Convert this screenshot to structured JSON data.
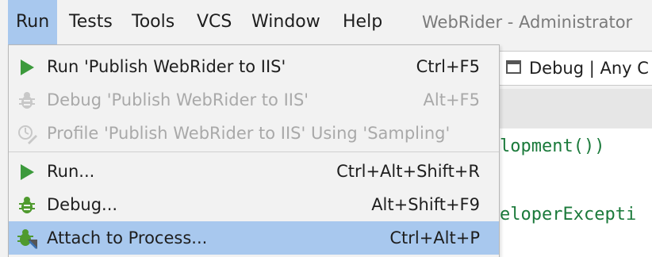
{
  "menubar": {
    "items": [
      {
        "label": "Run"
      },
      {
        "label": "Tests"
      },
      {
        "label": "Tools"
      },
      {
        "label": "VCS"
      },
      {
        "label": "Window"
      },
      {
        "label": "Help"
      }
    ],
    "window_title": "WebRider - Administrator"
  },
  "toolbar": {
    "configuration_label": "Debug | Any C"
  },
  "editor": {
    "lines": [
      "lopment())",
      "eloperExcepti"
    ]
  },
  "run_menu": {
    "items": [
      {
        "label": "Run 'Publish WebRider to IIS'",
        "shortcut": "Ctrl+F5",
        "icon": "run-triangle-icon",
        "enabled": true
      },
      {
        "label": "Debug 'Publish WebRider to IIS'",
        "shortcut": "Alt+F5",
        "icon": "debug-bug-icon",
        "enabled": false
      },
      {
        "label": "Profile 'Publish WebRider to IIS' Using 'Sampling'",
        "shortcut": "",
        "icon": "profile-icon",
        "enabled": false
      },
      {
        "label": "Run...",
        "shortcut": "Ctrl+Alt+Shift+R",
        "icon": "run-triangle-icon",
        "enabled": true
      },
      {
        "label": "Debug...",
        "shortcut": "Alt+Shift+F9",
        "icon": "debug-bug-icon",
        "enabled": true
      },
      {
        "label": "Attach to Process...",
        "shortcut": "Ctrl+Alt+P",
        "icon": "attach-process-icon",
        "enabled": true,
        "selected": true
      }
    ]
  },
  "colors": {
    "menu_background": "#f2f2f2",
    "selection": "#a8c8ee",
    "run_green": "#3c9a3c",
    "disabled_text": "#a9a9a9",
    "code_green": "#1b7a3b"
  }
}
